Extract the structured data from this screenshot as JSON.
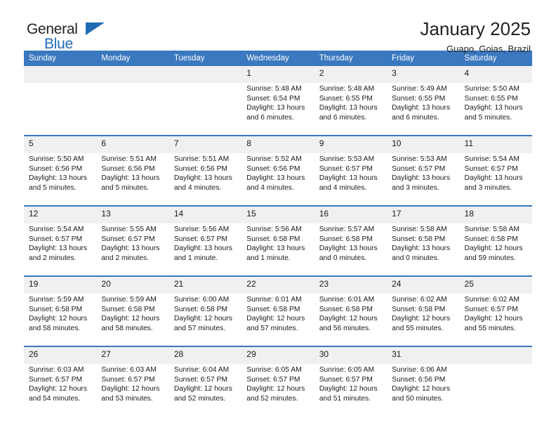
{
  "brand": {
    "name_part1": "General",
    "name_part2": "Blue",
    "triangle_color": "#1f6cb5"
  },
  "header": {
    "title": "January 2025",
    "subtitle": "Guapo, Goias, Brazil"
  },
  "theme": {
    "header_blue": "#3a78bf",
    "daynum_band": "#f0f0f0",
    "text": "#1a1a1a"
  },
  "weekday_headers": [
    "Sunday",
    "Monday",
    "Tuesday",
    "Wednesday",
    "Thursday",
    "Friday",
    "Saturday"
  ],
  "weeks": [
    [
      {
        "day": "",
        "sunrise": "",
        "sunset": "",
        "daylight": "",
        "daylight2": ""
      },
      {
        "day": "",
        "sunrise": "",
        "sunset": "",
        "daylight": "",
        "daylight2": ""
      },
      {
        "day": "",
        "sunrise": "",
        "sunset": "",
        "daylight": "",
        "daylight2": ""
      },
      {
        "day": "1",
        "sunrise": "Sunrise: 5:48 AM",
        "sunset": "Sunset: 6:54 PM",
        "daylight": "Daylight: 13 hours",
        "daylight2": "and 6 minutes."
      },
      {
        "day": "2",
        "sunrise": "Sunrise: 5:48 AM",
        "sunset": "Sunset: 6:55 PM",
        "daylight": "Daylight: 13 hours",
        "daylight2": "and 6 minutes."
      },
      {
        "day": "3",
        "sunrise": "Sunrise: 5:49 AM",
        "sunset": "Sunset: 6:55 PM",
        "daylight": "Daylight: 13 hours",
        "daylight2": "and 6 minutes."
      },
      {
        "day": "4",
        "sunrise": "Sunrise: 5:50 AM",
        "sunset": "Sunset: 6:55 PM",
        "daylight": "Daylight: 13 hours",
        "daylight2": "and 5 minutes."
      }
    ],
    [
      {
        "day": "5",
        "sunrise": "Sunrise: 5:50 AM",
        "sunset": "Sunset: 6:56 PM",
        "daylight": "Daylight: 13 hours",
        "daylight2": "and 5 minutes."
      },
      {
        "day": "6",
        "sunrise": "Sunrise: 5:51 AM",
        "sunset": "Sunset: 6:56 PM",
        "daylight": "Daylight: 13 hours",
        "daylight2": "and 5 minutes."
      },
      {
        "day": "7",
        "sunrise": "Sunrise: 5:51 AM",
        "sunset": "Sunset: 6:56 PM",
        "daylight": "Daylight: 13 hours",
        "daylight2": "and 4 minutes."
      },
      {
        "day": "8",
        "sunrise": "Sunrise: 5:52 AM",
        "sunset": "Sunset: 6:56 PM",
        "daylight": "Daylight: 13 hours",
        "daylight2": "and 4 minutes."
      },
      {
        "day": "9",
        "sunrise": "Sunrise: 5:53 AM",
        "sunset": "Sunset: 6:57 PM",
        "daylight": "Daylight: 13 hours",
        "daylight2": "and 4 minutes."
      },
      {
        "day": "10",
        "sunrise": "Sunrise: 5:53 AM",
        "sunset": "Sunset: 6:57 PM",
        "daylight": "Daylight: 13 hours",
        "daylight2": "and 3 minutes."
      },
      {
        "day": "11",
        "sunrise": "Sunrise: 5:54 AM",
        "sunset": "Sunset: 6:57 PM",
        "daylight": "Daylight: 13 hours",
        "daylight2": "and 3 minutes."
      }
    ],
    [
      {
        "day": "12",
        "sunrise": "Sunrise: 5:54 AM",
        "sunset": "Sunset: 6:57 PM",
        "daylight": "Daylight: 13 hours",
        "daylight2": "and 2 minutes."
      },
      {
        "day": "13",
        "sunrise": "Sunrise: 5:55 AM",
        "sunset": "Sunset: 6:57 PM",
        "daylight": "Daylight: 13 hours",
        "daylight2": "and 2 minutes."
      },
      {
        "day": "14",
        "sunrise": "Sunrise: 5:56 AM",
        "sunset": "Sunset: 6:57 PM",
        "daylight": "Daylight: 13 hours",
        "daylight2": "and 1 minute."
      },
      {
        "day": "15",
        "sunrise": "Sunrise: 5:56 AM",
        "sunset": "Sunset: 6:58 PM",
        "daylight": "Daylight: 13 hours",
        "daylight2": "and 1 minute."
      },
      {
        "day": "16",
        "sunrise": "Sunrise: 5:57 AM",
        "sunset": "Sunset: 6:58 PM",
        "daylight": "Daylight: 13 hours",
        "daylight2": "and 0 minutes."
      },
      {
        "day": "17",
        "sunrise": "Sunrise: 5:58 AM",
        "sunset": "Sunset: 6:58 PM",
        "daylight": "Daylight: 13 hours",
        "daylight2": "and 0 minutes."
      },
      {
        "day": "18",
        "sunrise": "Sunrise: 5:58 AM",
        "sunset": "Sunset: 6:58 PM",
        "daylight": "Daylight: 12 hours",
        "daylight2": "and 59 minutes."
      }
    ],
    [
      {
        "day": "19",
        "sunrise": "Sunrise: 5:59 AM",
        "sunset": "Sunset: 6:58 PM",
        "daylight": "Daylight: 12 hours",
        "daylight2": "and 58 minutes."
      },
      {
        "day": "20",
        "sunrise": "Sunrise: 5:59 AM",
        "sunset": "Sunset: 6:58 PM",
        "daylight": "Daylight: 12 hours",
        "daylight2": "and 58 minutes."
      },
      {
        "day": "21",
        "sunrise": "Sunrise: 6:00 AM",
        "sunset": "Sunset: 6:58 PM",
        "daylight": "Daylight: 12 hours",
        "daylight2": "and 57 minutes."
      },
      {
        "day": "22",
        "sunrise": "Sunrise: 6:01 AM",
        "sunset": "Sunset: 6:58 PM",
        "daylight": "Daylight: 12 hours",
        "daylight2": "and 57 minutes."
      },
      {
        "day": "23",
        "sunrise": "Sunrise: 6:01 AM",
        "sunset": "Sunset: 6:58 PM",
        "daylight": "Daylight: 12 hours",
        "daylight2": "and 56 minutes."
      },
      {
        "day": "24",
        "sunrise": "Sunrise: 6:02 AM",
        "sunset": "Sunset: 6:58 PM",
        "daylight": "Daylight: 12 hours",
        "daylight2": "and 55 minutes."
      },
      {
        "day": "25",
        "sunrise": "Sunrise: 6:02 AM",
        "sunset": "Sunset: 6:57 PM",
        "daylight": "Daylight: 12 hours",
        "daylight2": "and 55 minutes."
      }
    ],
    [
      {
        "day": "26",
        "sunrise": "Sunrise: 6:03 AM",
        "sunset": "Sunset: 6:57 PM",
        "daylight": "Daylight: 12 hours",
        "daylight2": "and 54 minutes."
      },
      {
        "day": "27",
        "sunrise": "Sunrise: 6:03 AM",
        "sunset": "Sunset: 6:57 PM",
        "daylight": "Daylight: 12 hours",
        "daylight2": "and 53 minutes."
      },
      {
        "day": "28",
        "sunrise": "Sunrise: 6:04 AM",
        "sunset": "Sunset: 6:57 PM",
        "daylight": "Daylight: 12 hours",
        "daylight2": "and 52 minutes."
      },
      {
        "day": "29",
        "sunrise": "Sunrise: 6:05 AM",
        "sunset": "Sunset: 6:57 PM",
        "daylight": "Daylight: 12 hours",
        "daylight2": "and 52 minutes."
      },
      {
        "day": "30",
        "sunrise": "Sunrise: 6:05 AM",
        "sunset": "Sunset: 6:57 PM",
        "daylight": "Daylight: 12 hours",
        "daylight2": "and 51 minutes."
      },
      {
        "day": "31",
        "sunrise": "Sunrise: 6:06 AM",
        "sunset": "Sunset: 6:56 PM",
        "daylight": "Daylight: 12 hours",
        "daylight2": "and 50 minutes."
      },
      {
        "day": "",
        "sunrise": "",
        "sunset": "",
        "daylight": "",
        "daylight2": ""
      }
    ]
  ]
}
